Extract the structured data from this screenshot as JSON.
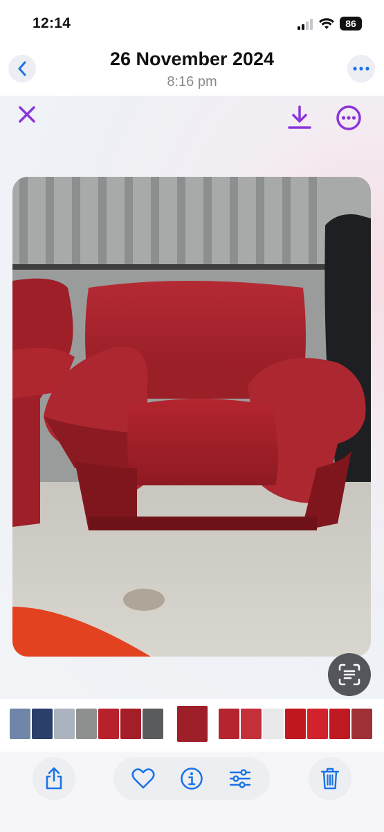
{
  "status_bar": {
    "time": "12:14",
    "battery": "86"
  },
  "nav": {
    "title": "26 November 2024",
    "subtitle": "8:16 pm"
  },
  "colors": {
    "accent_purple": "#8a35d9",
    "ios_blue": "#1a73e8",
    "sofa_red": "#a3202b"
  },
  "icons": [
    "back-chevron-icon",
    "ellipsis-icon",
    "close-x-icon",
    "download-icon",
    "more-circle-icon",
    "live-text-scan-icon",
    "share-icon",
    "heart-icon",
    "info-icon",
    "adjust-sliders-icon",
    "trash-icon"
  ],
  "photo": {
    "description_label": "Red leather armchair"
  }
}
